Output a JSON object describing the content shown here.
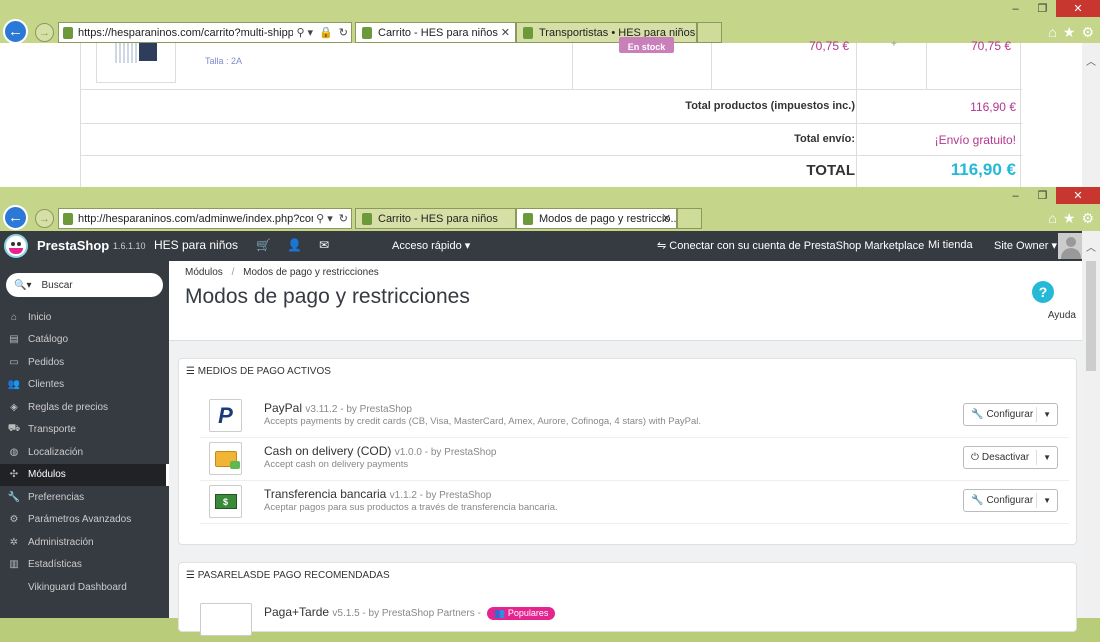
{
  "top_window": {
    "address": {
      "url": "https://hesparaninos.com/carrito?multi-shipping="
    },
    "tabs": [
      {
        "label": "Carrito - HES para niños",
        "active": true
      },
      {
        "label": "Transportistas • HES para niños",
        "active": false
      }
    ],
    "cart": {
      "status_badge": "En stock",
      "size_label": "Talla : 2A",
      "unit_price": "70,75 €",
      "line_total": "70,75 €",
      "qty_hint": "+",
      "total_products_label": "Total productos (impuestos inc.)",
      "total_products_value": "116,90 €",
      "shipping_label": "Total envío:",
      "shipping_value": "¡Envío gratuito!",
      "total_label": "TOTAL",
      "total_value": "116,90 €"
    }
  },
  "bottom_window": {
    "address": {
      "url": "http://hesparaninos.com/adminwe/index.php?control"
    },
    "tabs": [
      {
        "label": "Carrito - HES para niños",
        "active": false
      },
      {
        "label": "Modos de pago y restriccio...",
        "active": true
      }
    ],
    "header": {
      "brand": "PrestaShop",
      "version": "1.6.1.10",
      "shop_name": "HES para niños",
      "quick_access": "Acceso rápido",
      "marketplace": "Conectar con su cuenta de PrestaShop Marketplace",
      "my_shop": "Mi tienda",
      "owner": "Site Owner"
    },
    "sidebar": {
      "search_placeholder": "Buscar",
      "items": [
        {
          "label": "Inicio",
          "icon": "home-icon"
        },
        {
          "label": "Catálogo",
          "icon": "book-icon"
        },
        {
          "label": "Pedidos",
          "icon": "credit-card-icon"
        },
        {
          "label": "Clientes",
          "icon": "users-icon"
        },
        {
          "label": "Reglas de precios",
          "icon": "tags-icon"
        },
        {
          "label": "Transporte",
          "icon": "truck-icon"
        },
        {
          "label": "Localización",
          "icon": "globe-icon"
        },
        {
          "label": "Módulos",
          "icon": "puzzle-icon",
          "active": true
        },
        {
          "label": "Preferencias",
          "icon": "wrench-icon"
        },
        {
          "label": "Parámetros Avanzados",
          "icon": "cogs-icon"
        },
        {
          "label": "Administración",
          "icon": "cog-icon"
        },
        {
          "label": "Estadísticas",
          "icon": "bar-chart-icon"
        },
        {
          "label": "Vikinguard Dashboard",
          "icon": ""
        }
      ]
    },
    "breadcrumb": {
      "parent": "Módulos",
      "separator": "/",
      "current": "Modos de pago y restricciones"
    },
    "page_title": "Modos de pago y restricciones",
    "help_label": "Ayuda",
    "active_panel": {
      "title": "MEDIOS DE PAGO ACTIVOS",
      "modules": [
        {
          "name": "PayPal",
          "version": "v3.11.2 - by PrestaShop",
          "desc": "Accepts payments by credit cards (CB, Visa, MasterCard, Amex, Aurore, Cofinoga, 4 stars) with PayPal.",
          "action": "Configurar",
          "action_icon": "wrench-icon"
        },
        {
          "name": "Cash on delivery (COD)",
          "version": "v1.0.0 - by PrestaShop",
          "desc": "Accept cash on delivery payments",
          "action": "Desactivar",
          "action_icon": "power-icon"
        },
        {
          "name": "Transferencia bancaria",
          "version": "v1.1.2 - by PrestaShop",
          "desc": "Aceptar pagos para sus productos a través de transferencia bancaria.",
          "action": "Configurar",
          "action_icon": "wrench-icon"
        }
      ]
    },
    "recommended_panel": {
      "title": "PASARELASDE PAGO RECOMENDADAS",
      "modules": [
        {
          "name": "Paga+Tarde",
          "version": "v5.1.5 - by PrestaShop Partners -",
          "badge": "Populares"
        }
      ]
    }
  },
  "colors": {
    "accent": "#25b9d7",
    "pink": "#b3378f",
    "header_bg": "#363a41",
    "badge": "#e4248f"
  }
}
